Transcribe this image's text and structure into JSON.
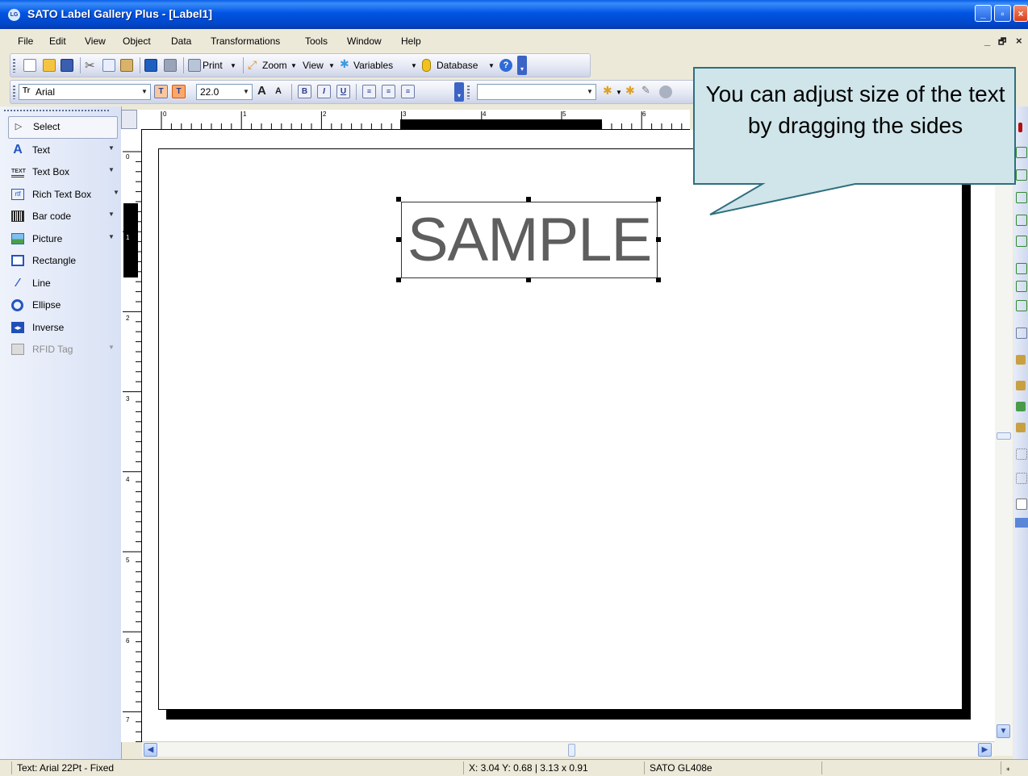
{
  "window": {
    "icon_text": "LG",
    "title": "SATO Label Gallery Plus - [Label1]",
    "controls": {
      "minimize": "_",
      "restore": "▫",
      "close": "×"
    }
  },
  "menu": {
    "items": [
      "File",
      "Edit",
      "View",
      "Object",
      "Data",
      "Transformations",
      "Tools",
      "Window",
      "Help"
    ],
    "mdi_controls": [
      "_",
      "🗗",
      "×"
    ]
  },
  "standard_toolbar": {
    "print_label": "Print",
    "zoom_label": "Zoom",
    "view_label": "View",
    "variables_label": "Variables",
    "database_label": "Database"
  },
  "format_toolbar": {
    "font_name": "Arial",
    "font_size": "22.0",
    "bold": "B",
    "italic": "I",
    "underline": "U"
  },
  "toolbox": {
    "items": [
      {
        "label": "Select",
        "icon": "pointer-icon",
        "has_dropdown": false
      },
      {
        "label": "Text",
        "icon": "text-icon",
        "has_dropdown": true
      },
      {
        "label": "Text Box",
        "icon": "textbox-icon",
        "has_dropdown": true
      },
      {
        "label": "Rich Text Box",
        "icon": "richtext-icon",
        "has_dropdown": true
      },
      {
        "label": "Bar code",
        "icon": "barcode-icon",
        "has_dropdown": true
      },
      {
        "label": "Picture",
        "icon": "picture-icon",
        "has_dropdown": true
      },
      {
        "label": "Rectangle",
        "icon": "rectangle-icon",
        "has_dropdown": false
      },
      {
        "label": "Line",
        "icon": "line-icon",
        "has_dropdown": false
      },
      {
        "label": "Ellipse",
        "icon": "ellipse-icon",
        "has_dropdown": false
      },
      {
        "label": "Inverse",
        "icon": "inverse-icon",
        "has_dropdown": false
      },
      {
        "label": "RFID Tag",
        "icon": "rfid-icon",
        "has_dropdown": true,
        "disabled": true
      }
    ]
  },
  "rulers": {
    "horizontal_ticks": [
      "0",
      "1",
      "2",
      "3",
      "4",
      "5",
      "6"
    ],
    "vertical_ticks": [
      "0",
      "1",
      "2",
      "3",
      "4",
      "5",
      "6",
      "7"
    ]
  },
  "label": {
    "sample_text": "SAMPLE"
  },
  "callout": {
    "text": "You can adjust size of the text by dragging the sides",
    "fill": "#cfe5ea"
  },
  "status": {
    "object_info": "Text: Arial 22Pt - Fixed",
    "coordinates": "X:  3.04 Y:  0.68  |  3.13 x 0.91",
    "printer": "SATO GL408e"
  }
}
